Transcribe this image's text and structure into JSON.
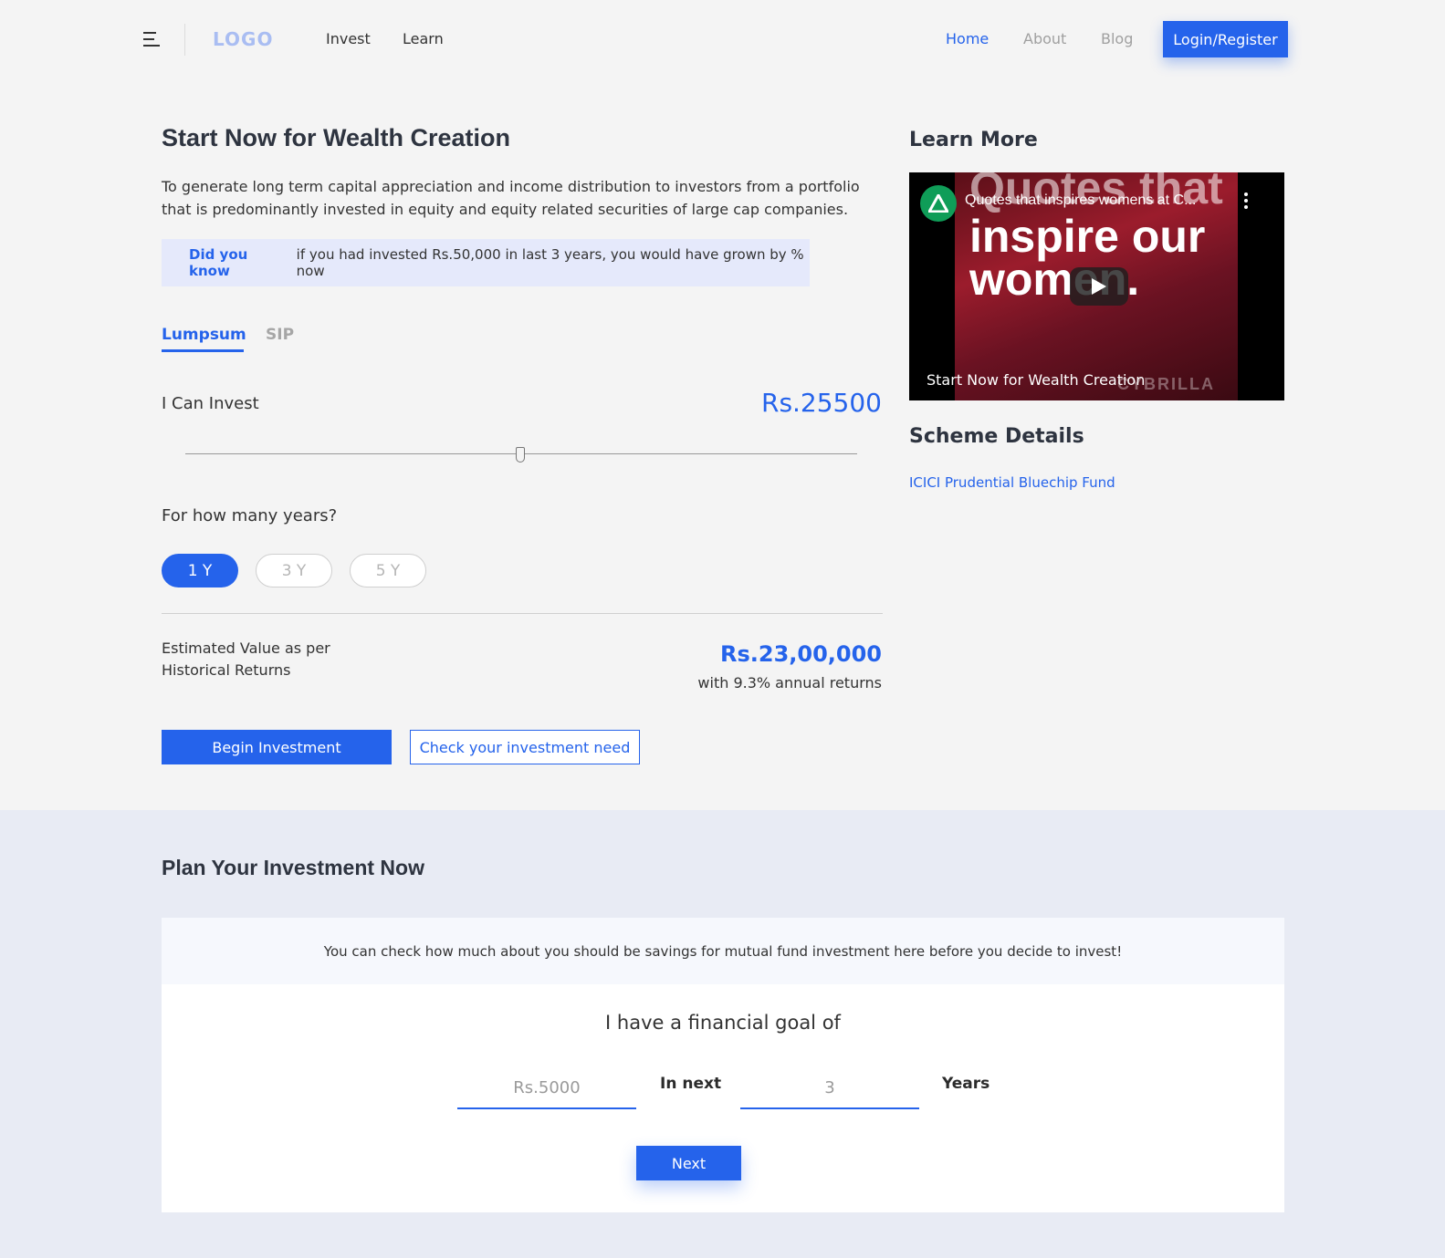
{
  "header": {
    "logo": "LOGO",
    "nav_left": [
      "Invest",
      "Learn"
    ],
    "nav_right": [
      "Home",
      "About",
      "Blog"
    ],
    "active_nav": "Home",
    "login_label": "Login/Register"
  },
  "main": {
    "title": "Start Now for Wealth Creation",
    "description": "To generate long term capital appreciation and income distribution to investors from a portfolio that is predominantly invested in equity and equity related securities of large cap companies.",
    "did_you_know": {
      "label": "Did you know",
      "text": "if you had invested Rs.50,000 in last 3 years, you would have grown by % now"
    },
    "tabs": [
      {
        "label": "Lumpsum",
        "active": true
      },
      {
        "label": "SIP",
        "active": false
      }
    ],
    "invest_label": "I Can Invest",
    "invest_amount": "Rs.25500",
    "years_label": "For how many years?",
    "year_options": [
      {
        "label": "1 Y",
        "selected": true
      },
      {
        "label": "3 Y",
        "selected": false
      },
      {
        "label": "5 Y",
        "selected": false
      }
    ],
    "estimated_label": "Estimated Value as per Historical Returns",
    "estimated_value": "Rs.23,00,000",
    "estimated_sub": "with 9.3% annual returns",
    "begin_button": "Begin Investment",
    "check_button": "Check your investment need"
  },
  "sidebar": {
    "learn_more_title": "Learn More",
    "video": {
      "title": "Quotes that inspires womens at C...",
      "overlay_text": [
        "Quotes that",
        "inspire our",
        "women."
      ],
      "caption": "Start Now for Wealth Creation",
      "brand": "CYBRILLA"
    },
    "scheme_title": "Scheme Details",
    "scheme_link": "ICICI Prudential Bluechip Fund"
  },
  "plan": {
    "title": "Plan Your Investment Now",
    "info": "You can check how much about you should be savings for mutual fund investment here before you decide to invest!",
    "goal_heading": "I have a financial goal of",
    "amount_placeholder": "Rs.5000",
    "in_next_label": "In next",
    "years_placeholder": "3",
    "years_label": "Years",
    "next_button": "Next"
  },
  "colors": {
    "accent": "#2563eb",
    "page_bg": "#f4f4f4",
    "section_bg": "#e8ebf4",
    "info_bg": "#e5e9fb",
    "muted": "#a0a0a0"
  }
}
